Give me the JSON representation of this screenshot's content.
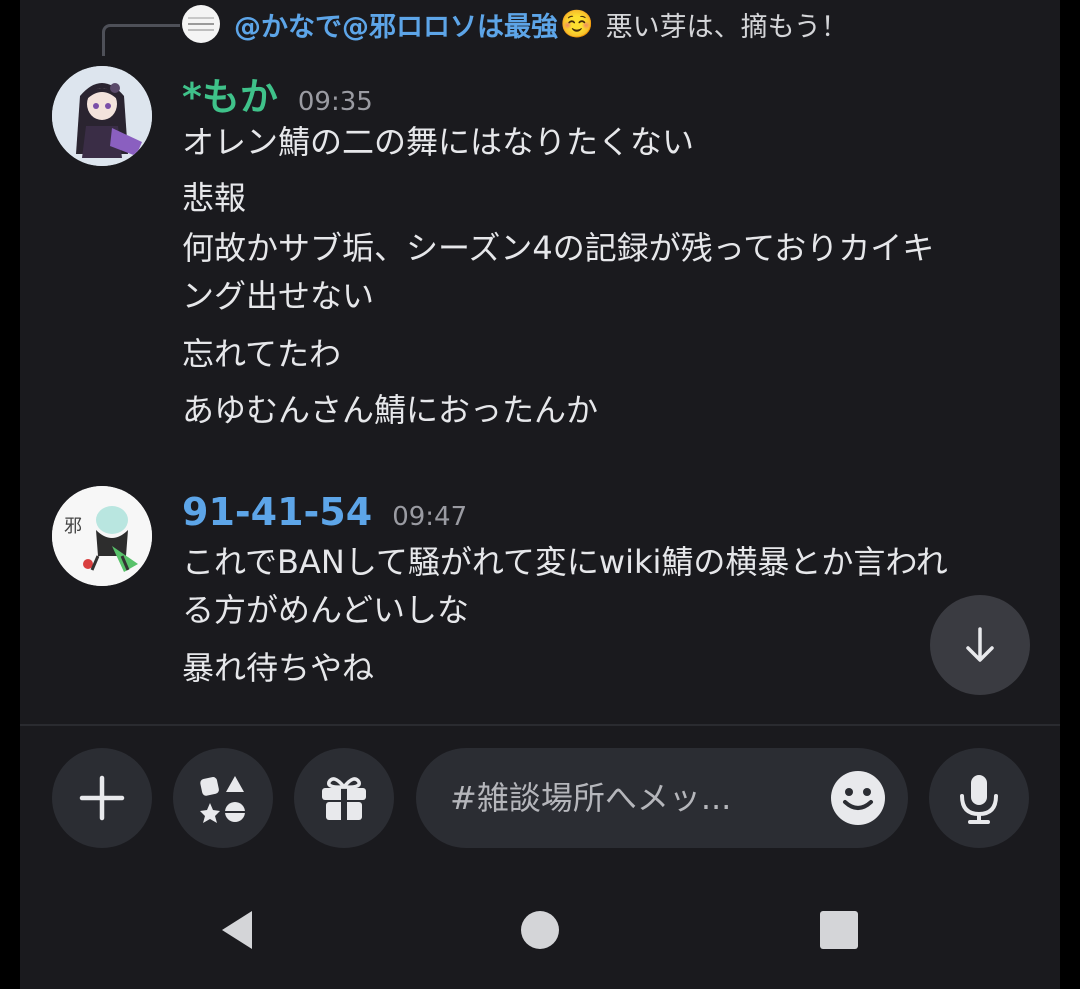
{
  "reply": {
    "mention": "@かなで@邪ロロソは最強",
    "emoji": "☺️",
    "text": "悪い芽は、摘もう！"
  },
  "messages": [
    {
      "author": "*もか",
      "time": "09:35",
      "lines": [
        "オレン鯖の二の舞にはなりたくない",
        "悲報",
        "何故かサブ垢、シーズン4の記録が残っておりカイキ",
        "ング出せない",
        "忘れてたわ",
        "あゆむんさん鯖におったんか"
      ]
    },
    {
      "author": "91-41-54",
      "time": "09:47",
      "lines": [
        "これでBANして騒がれて変にwiki鯖の横暴とか言われ",
        "る方がめんどいしな",
        "暴れ待ちやね"
      ]
    }
  ],
  "composer": {
    "placeholder": "#雑談場所へメッ..."
  },
  "icons": {
    "add": "plus-icon",
    "apps": "apps-icon",
    "gift": "gift-icon",
    "emoji": "emoji-icon",
    "mic": "microphone-icon",
    "scroll": "arrow-down-icon",
    "nav_back": "triangle-back-icon",
    "nav_home": "circle-home-icon",
    "nav_recents": "square-recents-icon"
  },
  "colors": {
    "background": "#1a1a1e",
    "name_moka": "#3fc28a",
    "name_914": "#5da5e8",
    "mention": "#5da5e8"
  }
}
